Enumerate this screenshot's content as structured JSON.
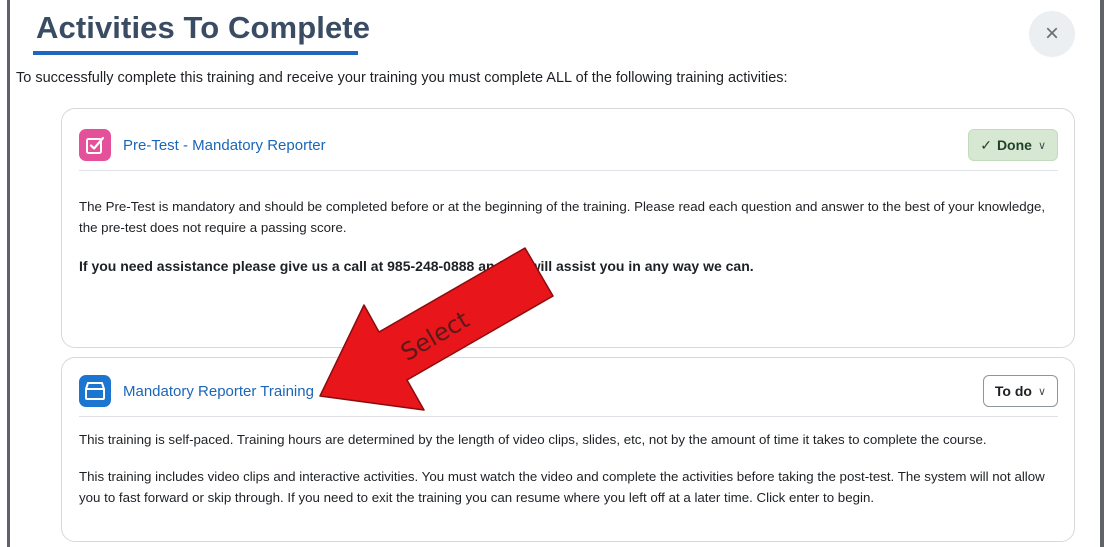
{
  "dialog": {
    "title": "Activities To Complete",
    "close_label": "×",
    "intro": "To successfully complete this training and receive your training you must complete ALL of the following training activities:"
  },
  "activities": [
    {
      "name": "Pre-Test - Mandatory Reporter",
      "icon": "quiz-checkbox-icon",
      "status": "Done",
      "description": "The Pre-Test is mandatory and should be completed before or at the beginning of the training.  Please read each question and answer to the best of your knowledge, the pre-test does not require a passing score.",
      "note": "If you need assistance please give us a call at 985-248-0888 and we will assist you in any way we can."
    },
    {
      "name": "Mandatory Reporter Training",
      "icon": "scorm-package-icon",
      "status": "To do",
      "description": "This training is self-paced. Training hours are determined by the length of video clips, slides, etc, not by the amount of time it takes to complete the course.",
      "description2": "This training includes video clips and interactive activities. You must watch the video and complete the activities before taking the post-test. The system will not allow you to fast forward or skip through. If you need to exit the training you can resume where you left off at a later time. Click enter to begin."
    }
  ],
  "annotation": {
    "label": "Select",
    "color": "#e8161b"
  }
}
